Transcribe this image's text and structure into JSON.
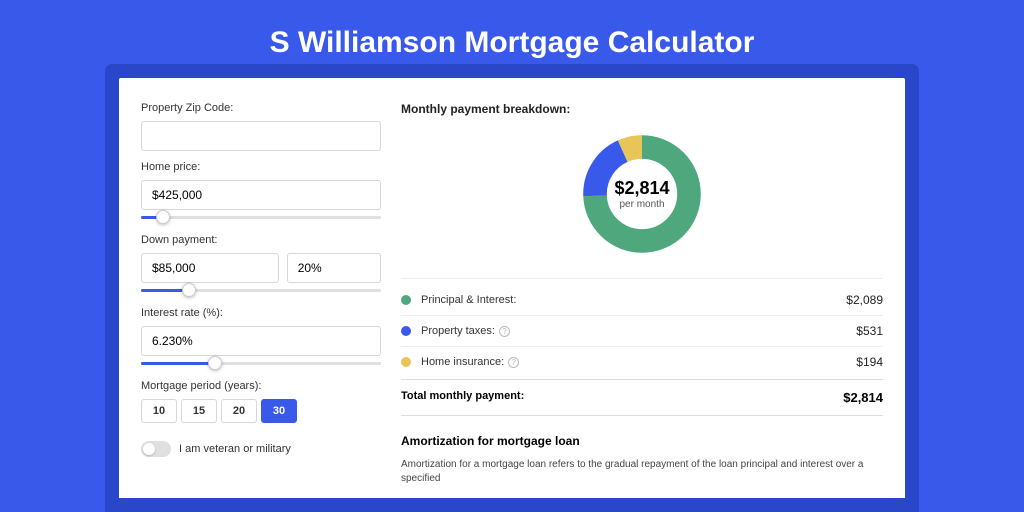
{
  "title": "S Williamson Mortgage Calculator",
  "form": {
    "zip_label": "Property Zip Code:",
    "zip_value": "",
    "home_price_label": "Home price:",
    "home_price_value": "$425,000",
    "home_price_slider_pct": 9,
    "down_payment_label": "Down payment:",
    "down_payment_value": "$85,000",
    "down_payment_pct": "20%",
    "down_payment_slider_pct": 20,
    "interest_label": "Interest rate (%):",
    "interest_value": "6.230%",
    "interest_slider_pct": 31,
    "period_label": "Mortgage period (years):",
    "periods": [
      "10",
      "15",
      "20",
      "30"
    ],
    "period_selected": "30",
    "veteran_label": "I am veteran or military"
  },
  "breakdown": {
    "header": "Monthly payment breakdown:",
    "center_amount": "$2,814",
    "center_sub": "per month",
    "items": [
      {
        "label": "Principal & Interest:",
        "value": "$2,089",
        "info": false
      },
      {
        "label": "Property taxes:",
        "value": "$531",
        "info": true
      },
      {
        "label": "Home insurance:",
        "value": "$194",
        "info": true
      }
    ],
    "total_label": "Total monthly payment:",
    "total_value": "$2,814"
  },
  "chart_data": {
    "type": "pie",
    "title": "Monthly payment breakdown",
    "series": [
      {
        "name": "Principal & Interest",
        "value": 2089,
        "color": "#4fa77e"
      },
      {
        "name": "Property taxes",
        "value": 531,
        "color": "#3959ea"
      },
      {
        "name": "Home insurance",
        "value": 194,
        "color": "#e8c557"
      }
    ],
    "total": 2814
  },
  "amort": {
    "header": "Amortization for mortgage loan",
    "text": "Amortization for a mortgage loan refers to the gradual repayment of the loan principal and interest over a specified"
  }
}
